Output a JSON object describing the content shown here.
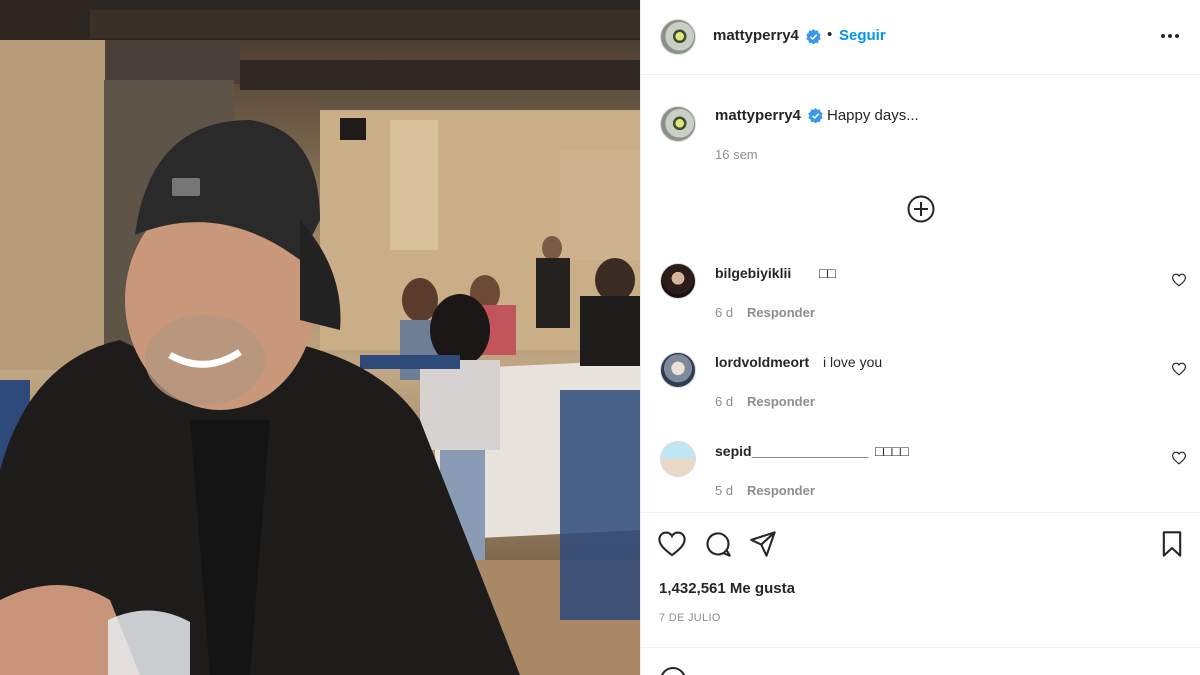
{
  "post": {
    "image_alt": "",
    "author": {
      "username": "mattyperry4",
      "verified": true,
      "follow_label": "Seguir",
      "separator": "•"
    },
    "caption": {
      "username": "mattyperry4",
      "text": "Happy days...",
      "time": "16 sem"
    },
    "load_more_icon": "plus-circle-icon",
    "comments": [
      {
        "username": "bilgebiyiklii",
        "text": "□□",
        "time": "6 d",
        "reply_label": "Responder"
      },
      {
        "username": "lordvoldmeort",
        "text": "i love you",
        "time": "6 d",
        "reply_label": "Responder"
      },
      {
        "username": "sepid_______________",
        "text": "□□□□",
        "time": "5 d",
        "reply_label": "Responder"
      }
    ],
    "likes_text": "1,432,561 Me gusta",
    "date_text": "7 DE JULIO"
  },
  "colors": {
    "link_blue": "#0095f6",
    "verified_blue": "#3897f0",
    "text": "#262626",
    "muted": "#8e8e8e",
    "divider": "#efefef"
  }
}
